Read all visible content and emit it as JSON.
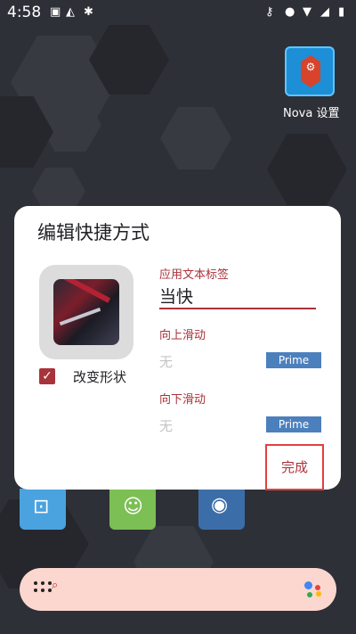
{
  "status_bar": {
    "time": "4:58"
  },
  "home": {
    "nova_app_label": "Nova 设置"
  },
  "dialog": {
    "title": "编辑快捷方式",
    "reshape_label": "改变形状",
    "app_label_caption": "应用文本标签",
    "app_label_value": "当快",
    "swipe_up_caption": "向上滑动",
    "swipe_up_value": "无",
    "swipe_up_badge": "Prime",
    "swipe_down_caption": "向下滑动",
    "swipe_down_value": "无",
    "swipe_down_badge": "Prime",
    "done_label": "完成"
  },
  "colors": {
    "accent": "#a9333a",
    "prime": "#4c80bd",
    "highlight": "#e0403e",
    "search_bar": "#fbd7cf"
  }
}
